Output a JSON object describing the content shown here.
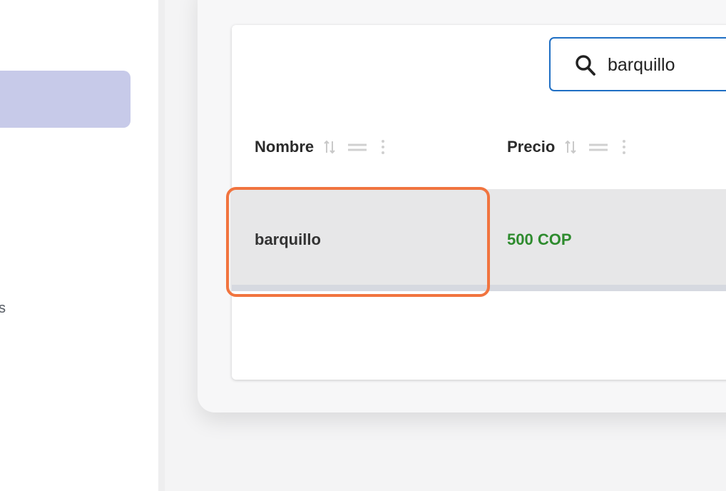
{
  "sidebar": {
    "partial_label": "s"
  },
  "search": {
    "value": "barquillo",
    "icon": "search-icon"
  },
  "table": {
    "columns": [
      {
        "label": "Nombre"
      },
      {
        "label": "Precio"
      }
    ],
    "rows": [
      {
        "nombre": "barquillo",
        "precio": "500 COP"
      }
    ]
  },
  "colors": {
    "accent": "#1f6fc4",
    "highlight": "#f1743f",
    "price": "#2e8b2e",
    "sidebar_active": "#c7cae9"
  }
}
